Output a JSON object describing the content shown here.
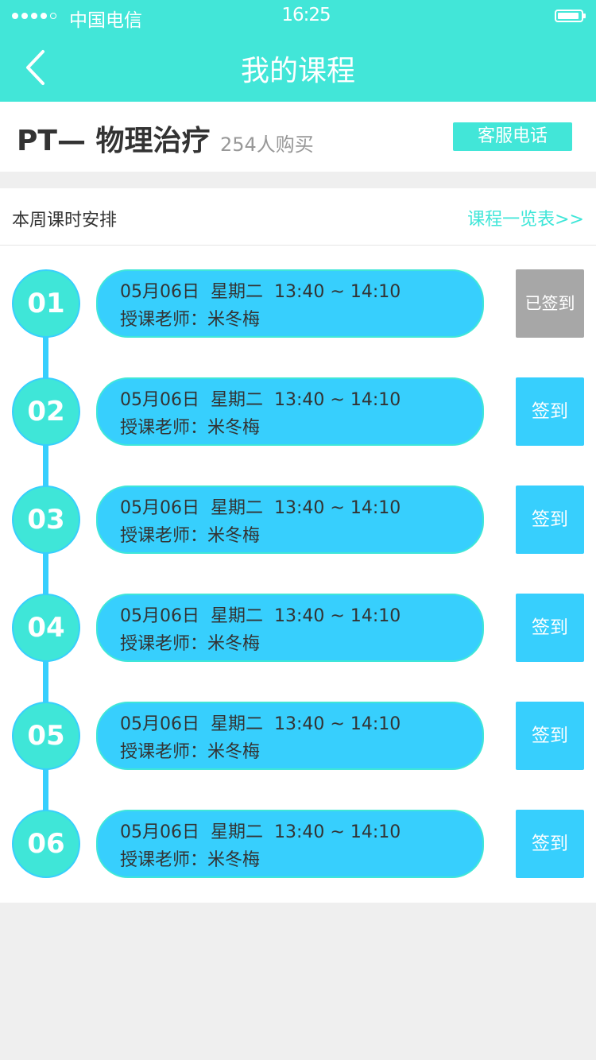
{
  "status_bar": {
    "carrier": "中国电信",
    "time": "16:25"
  },
  "header": {
    "title": "我的课程"
  },
  "course": {
    "name": "PT— 物理治疗",
    "buyers": "254人购买",
    "service_button": "客服电话"
  },
  "week": {
    "title": "本周课时安排",
    "overview_link": "课程一览表>>"
  },
  "colors": {
    "header": "#42e6d8",
    "card_fill": "#37cffd",
    "card_stroke": "#3fe6d8",
    "signed": "#a7a7a7"
  },
  "sessions": [
    {
      "number": "01",
      "date": "05月06日",
      "weekday": "星期二",
      "time": "13:40 ~ 14:10",
      "teacher": "授课老师：米冬梅",
      "button": "已签到",
      "signed": true
    },
    {
      "number": "02",
      "date": "05月06日",
      "weekday": "星期二",
      "time": "13:40 ~ 14:10",
      "teacher": "授课老师：米冬梅",
      "button": "签到",
      "signed": false
    },
    {
      "number": "03",
      "date": "05月06日",
      "weekday": "星期二",
      "time": "13:40 ~ 14:10",
      "teacher": "授课老师：米冬梅",
      "button": "签到",
      "signed": false
    },
    {
      "number": "04",
      "date": "05月06日",
      "weekday": "星期二",
      "time": "13:40 ~ 14:10",
      "teacher": "授课老师：米冬梅",
      "button": "签到",
      "signed": false
    },
    {
      "number": "05",
      "date": "05月06日",
      "weekday": "星期二",
      "time": "13:40 ~ 14:10",
      "teacher": "授课老师：米冬梅",
      "button": "签到",
      "signed": false
    },
    {
      "number": "06",
      "date": "05月06日",
      "weekday": "星期二",
      "time": "13:40 ~ 14:10",
      "teacher": "授课老师：米冬梅",
      "button": "签到",
      "signed": false
    }
  ]
}
